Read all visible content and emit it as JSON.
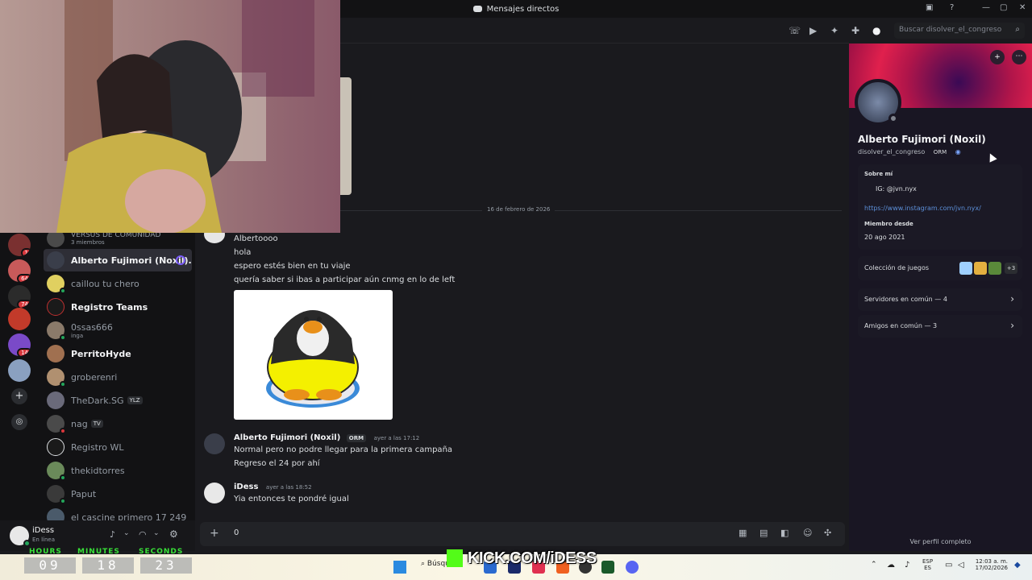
{
  "window": {
    "title": "Mensajes directos",
    "controls": [
      "—",
      "▢",
      "✕"
    ]
  },
  "guilds": [
    {
      "badge": "1"
    },
    {
      "badge": "64"
    },
    {
      "badge": "74"
    },
    {
      "badge": ""
    },
    {
      "badge": "14"
    },
    {
      "badge": ""
    }
  ],
  "dm_list": [
    {
      "name": "VERSUS DE COMUNIDAD",
      "sub": "3 miembros",
      "bold": false
    },
    {
      "name": "Alberto Fujimori (Noxil)...",
      "bold": true,
      "active": true
    },
    {
      "name": "caillou tu chero",
      "bold": false
    },
    {
      "name": "Registro Teams",
      "bold": true
    },
    {
      "name": "0ssas666",
      "sub": "inga",
      "bold": false
    },
    {
      "name": "PerritoHyde",
      "bold": true
    },
    {
      "name": "groberenri",
      "bold": false
    },
    {
      "name": "TheDark.SG",
      "tag": "YLZ",
      "bold": false
    },
    {
      "name": "nag",
      "tag": "TV",
      "bold": false
    },
    {
      "name": "Registro WL",
      "bold": false
    },
    {
      "name": "thekidtorres",
      "bold": false
    },
    {
      "name": "Paput",
      "bold": false
    },
    {
      "name": "el cascine primero 17 249",
      "bold": false
    }
  ],
  "user_panel": {
    "name": "iDess",
    "status": "En línea"
  },
  "header": {
    "search_placeholder": "Buscar disolver_el_congreso"
  },
  "chat": {
    "date_divider": "16 de febrero de 2026",
    "messages_continued": [
      "Albertoooo",
      "hola",
      "espero estés bien en tu viaje",
      "quería saber si ibas a participar aún cnmg en lo de left"
    ],
    "reply": {
      "author": "Alberto Fujimori (Noxil)",
      "tag": "ORM",
      "timestamp": "ayer a las 17:12",
      "lines": [
        "Normal pero no podre llegar para la primera campaña",
        "Regreso el 24 por ahí"
      ]
    },
    "own": {
      "author": "iDess",
      "timestamp": "ayer a las 18:52",
      "lines": [
        "Yia entonces te pondré igual"
      ]
    },
    "composer_value": "0"
  },
  "profile": {
    "display_name": "Alberto Fujimori (Noxil)",
    "username": "disolver_el_congreso",
    "tag": "ORM",
    "about_title": "Sobre mí",
    "about_ig": "IG: @jvn.nyx",
    "about_link": "https://www.instagram.com/jvn.nyx/",
    "member_since_title": "Miembro desde",
    "member_since": "20 ago 2021",
    "games_label": "Colección de juegos",
    "games_more": "+3",
    "servers_common": "Servidores en común — 4",
    "friends_common": "Amigos en común — 3",
    "view_full": "Ver perfil completo"
  },
  "timer": {
    "labels": [
      "HOURS",
      "MINUTES",
      "SECONDS"
    ],
    "hours": "09",
    "minutes": "18",
    "seconds": "23"
  },
  "overlay": {
    "kick_text": "KICK.COM/iDESS"
  },
  "taskbar": {
    "search_label": "Búsqueda",
    "lang": "ESP",
    "lang_sub": "ES",
    "time": "12:03 a. m.",
    "date": "17/02/2026"
  },
  "colors": {
    "accent": "#5865f2",
    "online": "#23a55a",
    "badge": "#da373c",
    "link": "#00a8fc",
    "timer_green": "#38e038"
  }
}
